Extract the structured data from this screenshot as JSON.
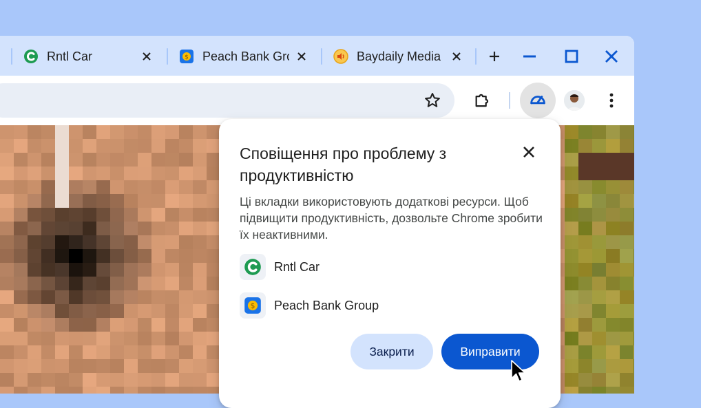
{
  "tabs": [
    {
      "title": "Rntl Car",
      "favicon": "rntl-car-icon",
      "close": "close-icon"
    },
    {
      "title": "Peach Bank Gro",
      "favicon": "peach-bank-icon",
      "close": "close-icon"
    },
    {
      "title": "Baydaily Media",
      "favicon": "baydaily-media-icon",
      "close": "close-icon"
    }
  ],
  "window_controls": {
    "new_tab": "+",
    "minimize": "minimize-icon",
    "maximize": "maximize-icon",
    "close": "close-icon"
  },
  "toolbar": {
    "bookmark": "star-icon",
    "extensions": "puzzle-icon",
    "performance": "speedometer-icon",
    "profile": "avatar",
    "menu": "more-vert-icon"
  },
  "dialog": {
    "title": "Сповіщення про проблему з продуктивністю",
    "body": "Ці вкладки використовують додаткові ресурси. Щоб підвищити продуктивність, дозвольте Chrome зробити їх неактивними.",
    "sites": [
      {
        "label": "Rntl Car",
        "icon": "rntl-car-icon"
      },
      {
        "label": "Peach Bank Group",
        "icon": "peach-bank-icon"
      }
    ],
    "close_button": "Закрити",
    "fix_button": "Виправити"
  },
  "colors": {
    "background": "#a9c7fa",
    "tabstrip": "#d3e3fd",
    "accent": "#0b57d0",
    "window_close": "#0b57d0"
  }
}
